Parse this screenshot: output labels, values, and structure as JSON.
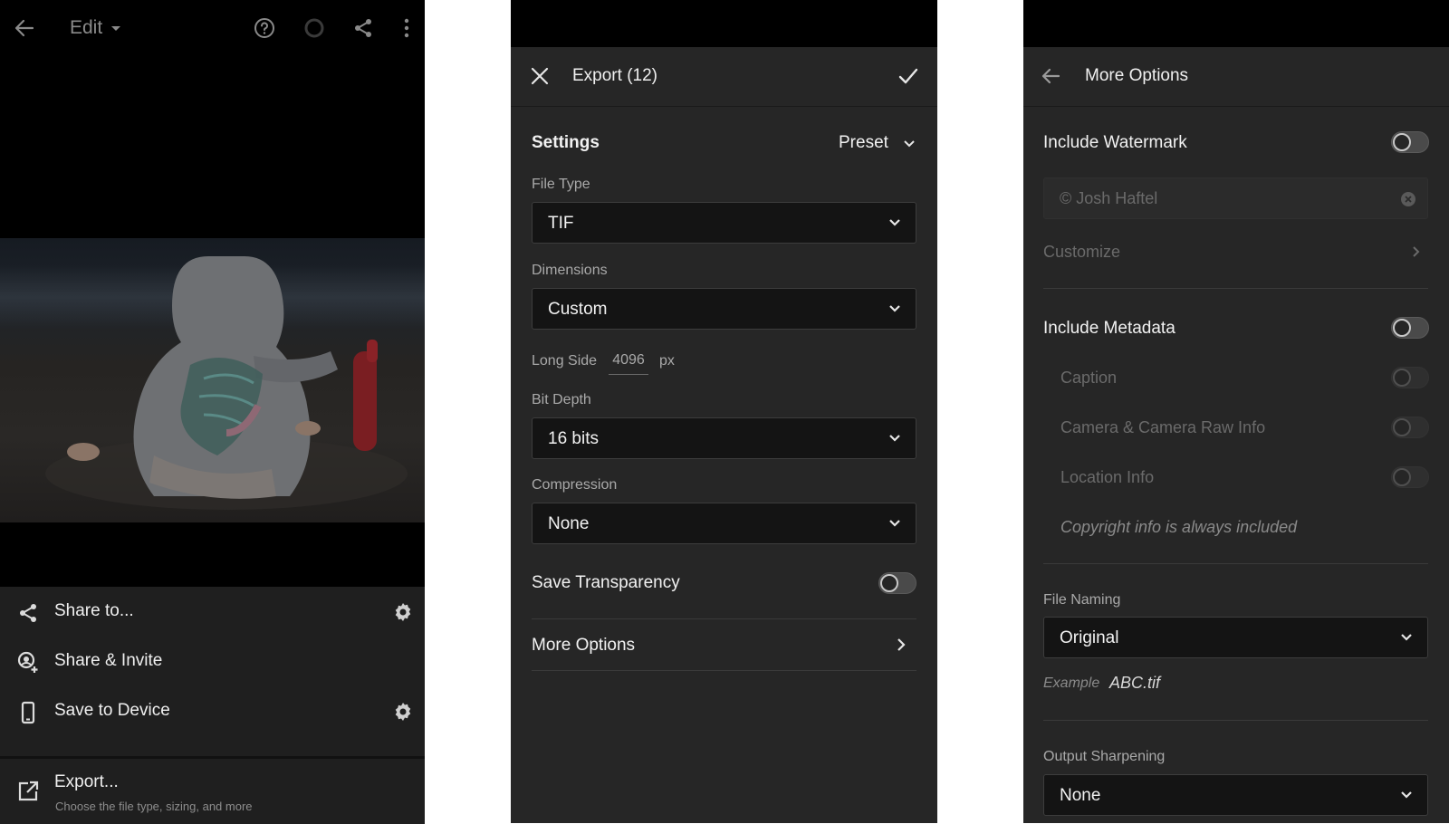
{
  "edit_screen": {
    "title": "Edit",
    "share_to_label": "Share to...",
    "share_invite_label": "Share & Invite",
    "save_device_label": "Save to Device",
    "export_label": "Export...",
    "export_sub": "Choose the file type, sizing, and more"
  },
  "export_screen": {
    "title": "Export (12)",
    "settings_label": "Settings",
    "preset_label": "Preset",
    "file_type_label": "File Type",
    "file_type_value": "TIF",
    "dimensions_label": "Dimensions",
    "dimensions_value": "Custom",
    "long_side_label": "Long Side",
    "long_side_value": "4096",
    "long_side_unit": "px",
    "bit_depth_label": "Bit Depth",
    "bit_depth_value": "16 bits",
    "compression_label": "Compression",
    "compression_value": "None",
    "save_transparency_label": "Save Transparency",
    "save_transparency_on": false,
    "more_options_label": "More Options"
  },
  "more_options_screen": {
    "title": "More Options",
    "include_watermark_label": "Include Watermark",
    "include_watermark_on": false,
    "watermark_text": "© Josh Haftel",
    "customize_label": "Customize",
    "include_metadata_label": "Include Metadata",
    "include_metadata_on": false,
    "caption_label": "Caption",
    "camera_raw_label": "Camera & Camera Raw Info",
    "location_label": "Location Info",
    "copyright_note": "Copyright info is always included",
    "file_naming_label": "File Naming",
    "file_naming_value": "Original",
    "example_label": "Example",
    "example_value": "ABC.tif",
    "output_sharpening_label": "Output Sharpening",
    "output_sharpening_value": "None"
  },
  "colors": {
    "panel_bg": "#262626",
    "field_bg": "#141414",
    "text": "#f2f2f2",
    "muted": "#a9a9a9"
  }
}
